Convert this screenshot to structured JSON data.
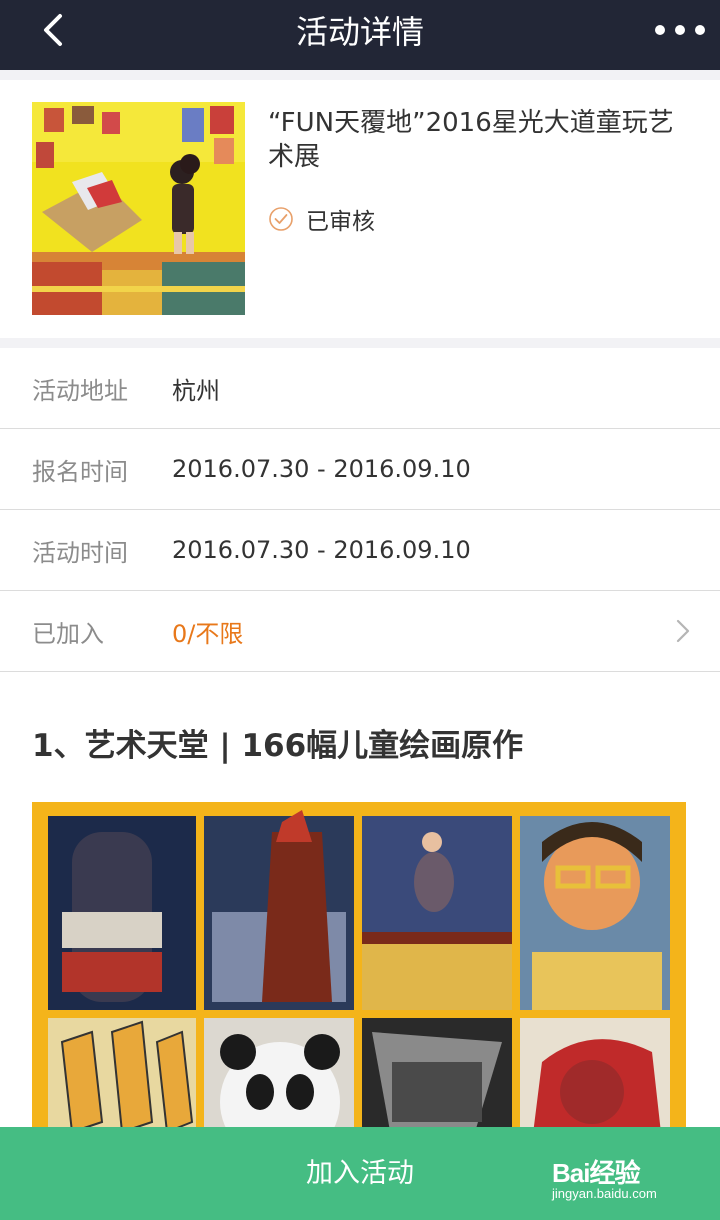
{
  "nav": {
    "title": "活动详情"
  },
  "event": {
    "title": "“FUN天覆地”2016星光大道童玩艺术展",
    "status": "已审核"
  },
  "info": [
    {
      "label": "活动地址",
      "value": "杭州"
    },
    {
      "label": "报名时间",
      "value": "2016.07.30 - 2016.09.10"
    },
    {
      "label": "活动时间",
      "value": "2016.07.30 - 2016.09.10"
    },
    {
      "label": "已加入",
      "value": "0/不限"
    }
  ],
  "section": {
    "title": "1、艺术天堂 | 166幅儿童绘画原作"
  },
  "bottom": {
    "join_label": "加入活动"
  },
  "watermark": {
    "brand": "Bai经验",
    "url": "jingyan.baidu.com"
  },
  "colors": {
    "navbar": "#222636",
    "accent_green": "#45bd83",
    "accent_orange": "#e8781a",
    "status_check": "#e8a06a"
  },
  "icons": {
    "back": "chevron-left-icon",
    "more": "more-dots-icon",
    "status": "check-circle-icon",
    "row": "chevron-right-icon"
  }
}
